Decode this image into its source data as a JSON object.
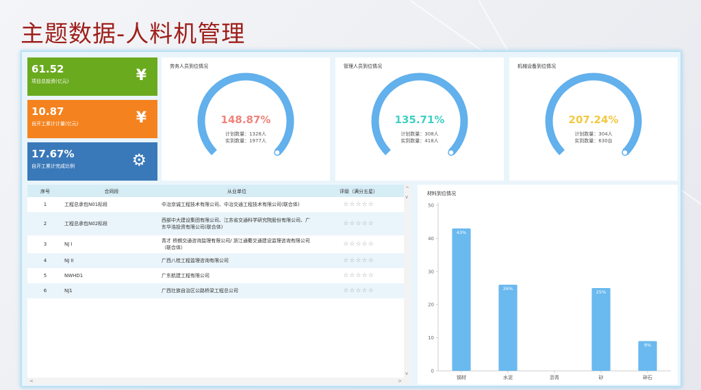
{
  "page": {
    "title": "主题数据-人料机管理"
  },
  "kpis": [
    {
      "value": "61.52",
      "label": "项目总投资(亿元)",
      "icon": "yen-icon",
      "glyph": "¥",
      "color": "#6aaa1e"
    },
    {
      "value": "10.87",
      "label": "自开工累计计量(亿元)",
      "icon": "yen-icon",
      "glyph": "¥",
      "color": "#f4831f"
    },
    {
      "value": "17.67%",
      "label": "自开工累计完成比例",
      "icon": "gear-icon",
      "glyph": "⚙",
      "color": "#3a79b9"
    }
  ],
  "gauges": [
    {
      "title": "劳务人员到位情况",
      "percent": "148.87%",
      "line1": "计划数量：1328人",
      "line2": "实到数量：1977人",
      "fill": 1.0,
      "accent": "#f0837a"
    },
    {
      "title": "管理人员到位情况",
      "percent": "135.71%",
      "line1": "计划数量：308人",
      "line2": "实到数量：418人",
      "fill": 1.0,
      "accent": "#3fd0c4"
    },
    {
      "title": "机械设备到位情况",
      "percent": "207.24%",
      "line1": "计划数量：304人",
      "line2": "实到数量：630台",
      "fill": 1.0,
      "accent": "#f3c942"
    }
  ],
  "table": {
    "headers": {
      "index": "序号",
      "contract": "合同段",
      "unit": "从业单位",
      "rating": "评级（满分五星）"
    },
    "rows": [
      {
        "index": "1",
        "contract": "工程总承包N01标段",
        "unit": "中冶京诚工程技术有限公司、中冶交通工程技术有限公司(联合体)",
        "stars": "☆☆☆☆☆"
      },
      {
        "index": "2",
        "contract": "工程总承包N02标段",
        "unit": "西部中大建设集团有限公司、江苏省交通科学研究院股份有限公司、广东华浩投资有限公司(联合体)",
        "stars": "☆☆☆☆☆"
      },
      {
        "index": "3",
        "contract": "NJ I",
        "unit": "青才 桥朗交通咨询监理有限公司/ 浙江通衢交通建设监理咨询有限公司（联合体）",
        "stars": "☆☆☆☆☆"
      },
      {
        "index": "4",
        "contract": "NJ II",
        "unit": "广西八桂工程监理咨询有限公司",
        "stars": "☆☆☆☆☆"
      },
      {
        "index": "5",
        "contract": "NWHD1",
        "unit": "广东航建工程有限公司",
        "stars": "☆☆☆☆☆"
      },
      {
        "index": "6",
        "contract": "NJ1",
        "unit": "广西壮族自治区公路桥梁工程总公司",
        "stars": "☆☆☆☆☆"
      }
    ]
  },
  "chart_title": "材料到位情况",
  "chart_data": {
    "type": "bar",
    "categories": [
      "钢材",
      "水泥",
      "沥青",
      "砂",
      "碎石"
    ],
    "values": [
      43,
      26,
      0,
      25,
      9
    ],
    "data_labels": [
      "43%",
      "26%",
      "",
      "25%",
      "9%"
    ],
    "ylim": [
      0,
      50
    ],
    "yticks": [
      0,
      10,
      20,
      30,
      40,
      50
    ],
    "bar_color": "#6ab9ef",
    "grid": false
  }
}
